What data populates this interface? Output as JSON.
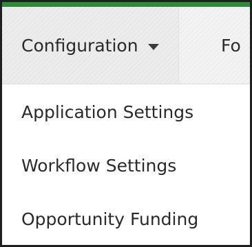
{
  "colors": {
    "accent": "#2e8b3a"
  },
  "nav": {
    "items": [
      {
        "label": "Configuration",
        "has_dropdown": true,
        "active": true
      },
      {
        "label": "Fo"
      }
    ],
    "caret_icon": "caret-down-icon"
  },
  "dropdown": {
    "items": [
      {
        "label": "Application Settings"
      },
      {
        "label": "Workflow Settings"
      },
      {
        "label": "Opportunity Funding"
      }
    ]
  }
}
